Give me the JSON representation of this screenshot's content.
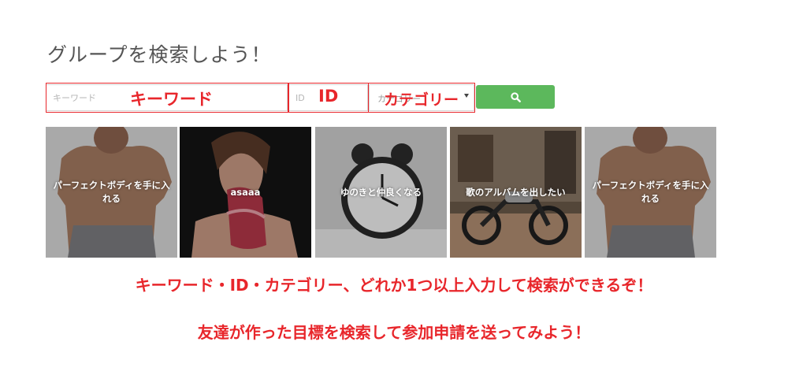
{
  "page": {
    "title": "グループを検索しよう！"
  },
  "search": {
    "keyword_placeholder": "キーワード",
    "id_placeholder": "ID",
    "category_selected": "カテゴリー",
    "button_icon": "search-icon",
    "button_color": "#5cb85c"
  },
  "annotations": {
    "keyword": "キーワード",
    "id": "ID",
    "category": "カテゴリー",
    "color": "#e8262b"
  },
  "groups": [
    {
      "title": "パーフェクトボディを手に入れる",
      "image": "muscular-man-photo"
    },
    {
      "title": "asaaa",
      "image": "woman-eating-meat-photo"
    },
    {
      "title": "ゆのきと仲良くなる",
      "image": "alarm-clock-photo"
    },
    {
      "title": "歌のアルバムを出したい",
      "image": "motorcycle-garage-photo"
    },
    {
      "title": "パーフェクトボディを手に入れる",
      "image": "muscular-man-photo"
    }
  ],
  "notes": {
    "line1": "キーワード・ID・カテゴリー、どれか1つ以上入力して検索ができるぞ！",
    "line2": "友達が作った目標を検索して参加申請を送ってみよう！"
  }
}
